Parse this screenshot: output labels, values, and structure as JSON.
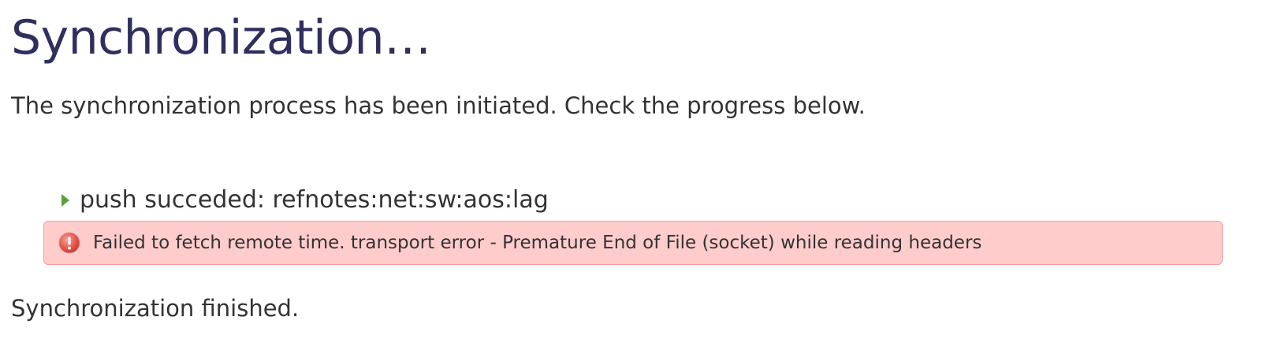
{
  "page": {
    "title": "Synchronization…",
    "intro": "The synchronization process has been initiated. Check the progress below.",
    "footer": "Synchronization finished."
  },
  "log": {
    "items": [
      {
        "text": "push succeded: refnotes:net:sw:aos:lag",
        "icon": "arrow-right-icon",
        "color": "#5a9e3a"
      }
    ]
  },
  "error": {
    "icon": "error-icon",
    "message": "Failed to fetch remote time. transport error - Premature End of File (socket) while reading headers",
    "background": "#ffcccc",
    "icon_color": "#e85a50"
  }
}
